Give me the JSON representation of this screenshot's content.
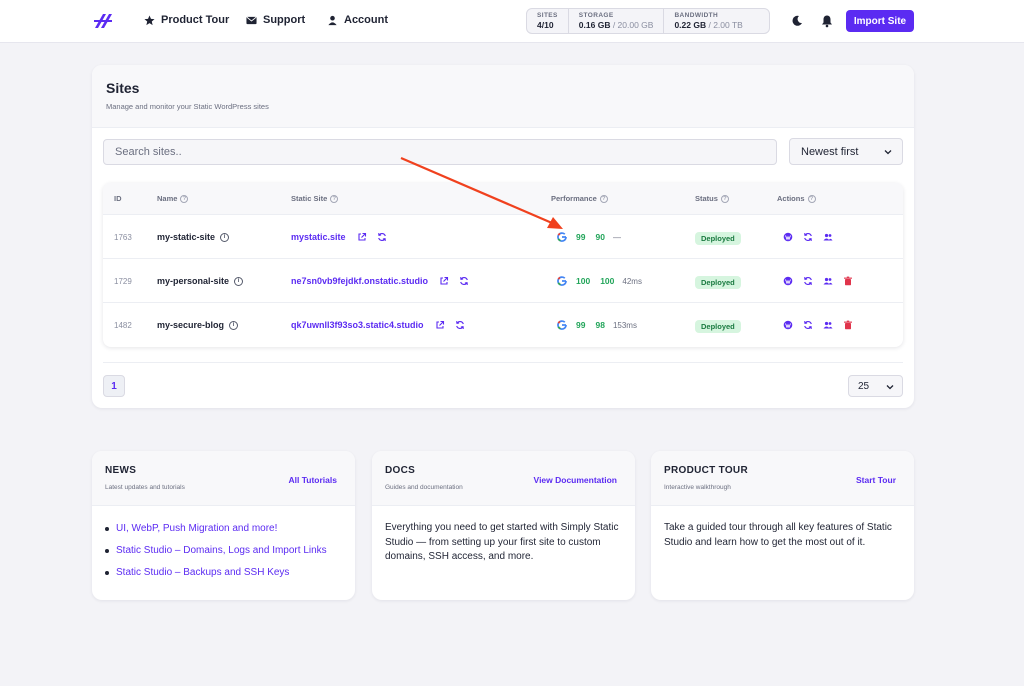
{
  "nav": {
    "links": [
      "Product Tour",
      "Support",
      "Account"
    ],
    "usage": [
      {
        "label": "SITES",
        "value": "4/10",
        "limit": ""
      },
      {
        "label": "STORAGE",
        "value": "0.16 GB",
        "limit": " / 20.00 GB"
      },
      {
        "label": "BANDWIDTH",
        "value": "0.22 GB",
        "limit": " / 2.00 TB"
      }
    ],
    "import_label": "Import Site"
  },
  "sites": {
    "title": "Sites",
    "subtitle": "Manage and monitor your Static WordPress sites",
    "search_placeholder": "Search sites..",
    "sort_value": "Newest first",
    "columns": [
      "ID",
      "Name",
      "Static Site",
      "Performance",
      "Status",
      "Actions"
    ],
    "rows": [
      {
        "id": "1763",
        "name": "my-static-site",
        "url": "mystatic.site",
        "score1": "99",
        "score2": "90",
        "time": "—",
        "status": "Deployed"
      },
      {
        "id": "1729",
        "name": "my-personal-site",
        "url": "ne7sn0vb9fejdkf.onstatic.studio",
        "score1": "100",
        "score2": "100",
        "time": "42ms",
        "status": "Deployed"
      },
      {
        "id": "1482",
        "name": "my-secure-blog",
        "url": "qk7uwnll3f93so3.static4.studio",
        "score1": "99",
        "score2": "98",
        "time": "153ms",
        "status": "Deployed"
      }
    ],
    "page": "1",
    "per_page": "25"
  },
  "news": {
    "title": "NEWS",
    "subtitle": "Latest updates and tutorials",
    "link": "All Tutorials",
    "items": [
      "UI, WebP, Push Migration and more!",
      "Static Studio – Domains, Logs and Import Links",
      "Static Studio – Backups and SSH Keys"
    ]
  },
  "docs": {
    "title": "DOCS",
    "subtitle": "Guides and documentation",
    "link": "View Documentation",
    "body": "Everything you need to get started with Simply Static Studio — from setting up your first site to custom domains, SSH access, and more."
  },
  "tour": {
    "title": "PRODUCT TOUR",
    "subtitle": "Interactive walkthrough",
    "link": "Start Tour",
    "body": "Take a guided tour through all key features of Static Studio and learn how to get the most out of it."
  },
  "colors": {
    "accent": "#5b2bf2",
    "success": "#22a55a",
    "danger": "#e0344b",
    "annotation": "#f0411e"
  }
}
